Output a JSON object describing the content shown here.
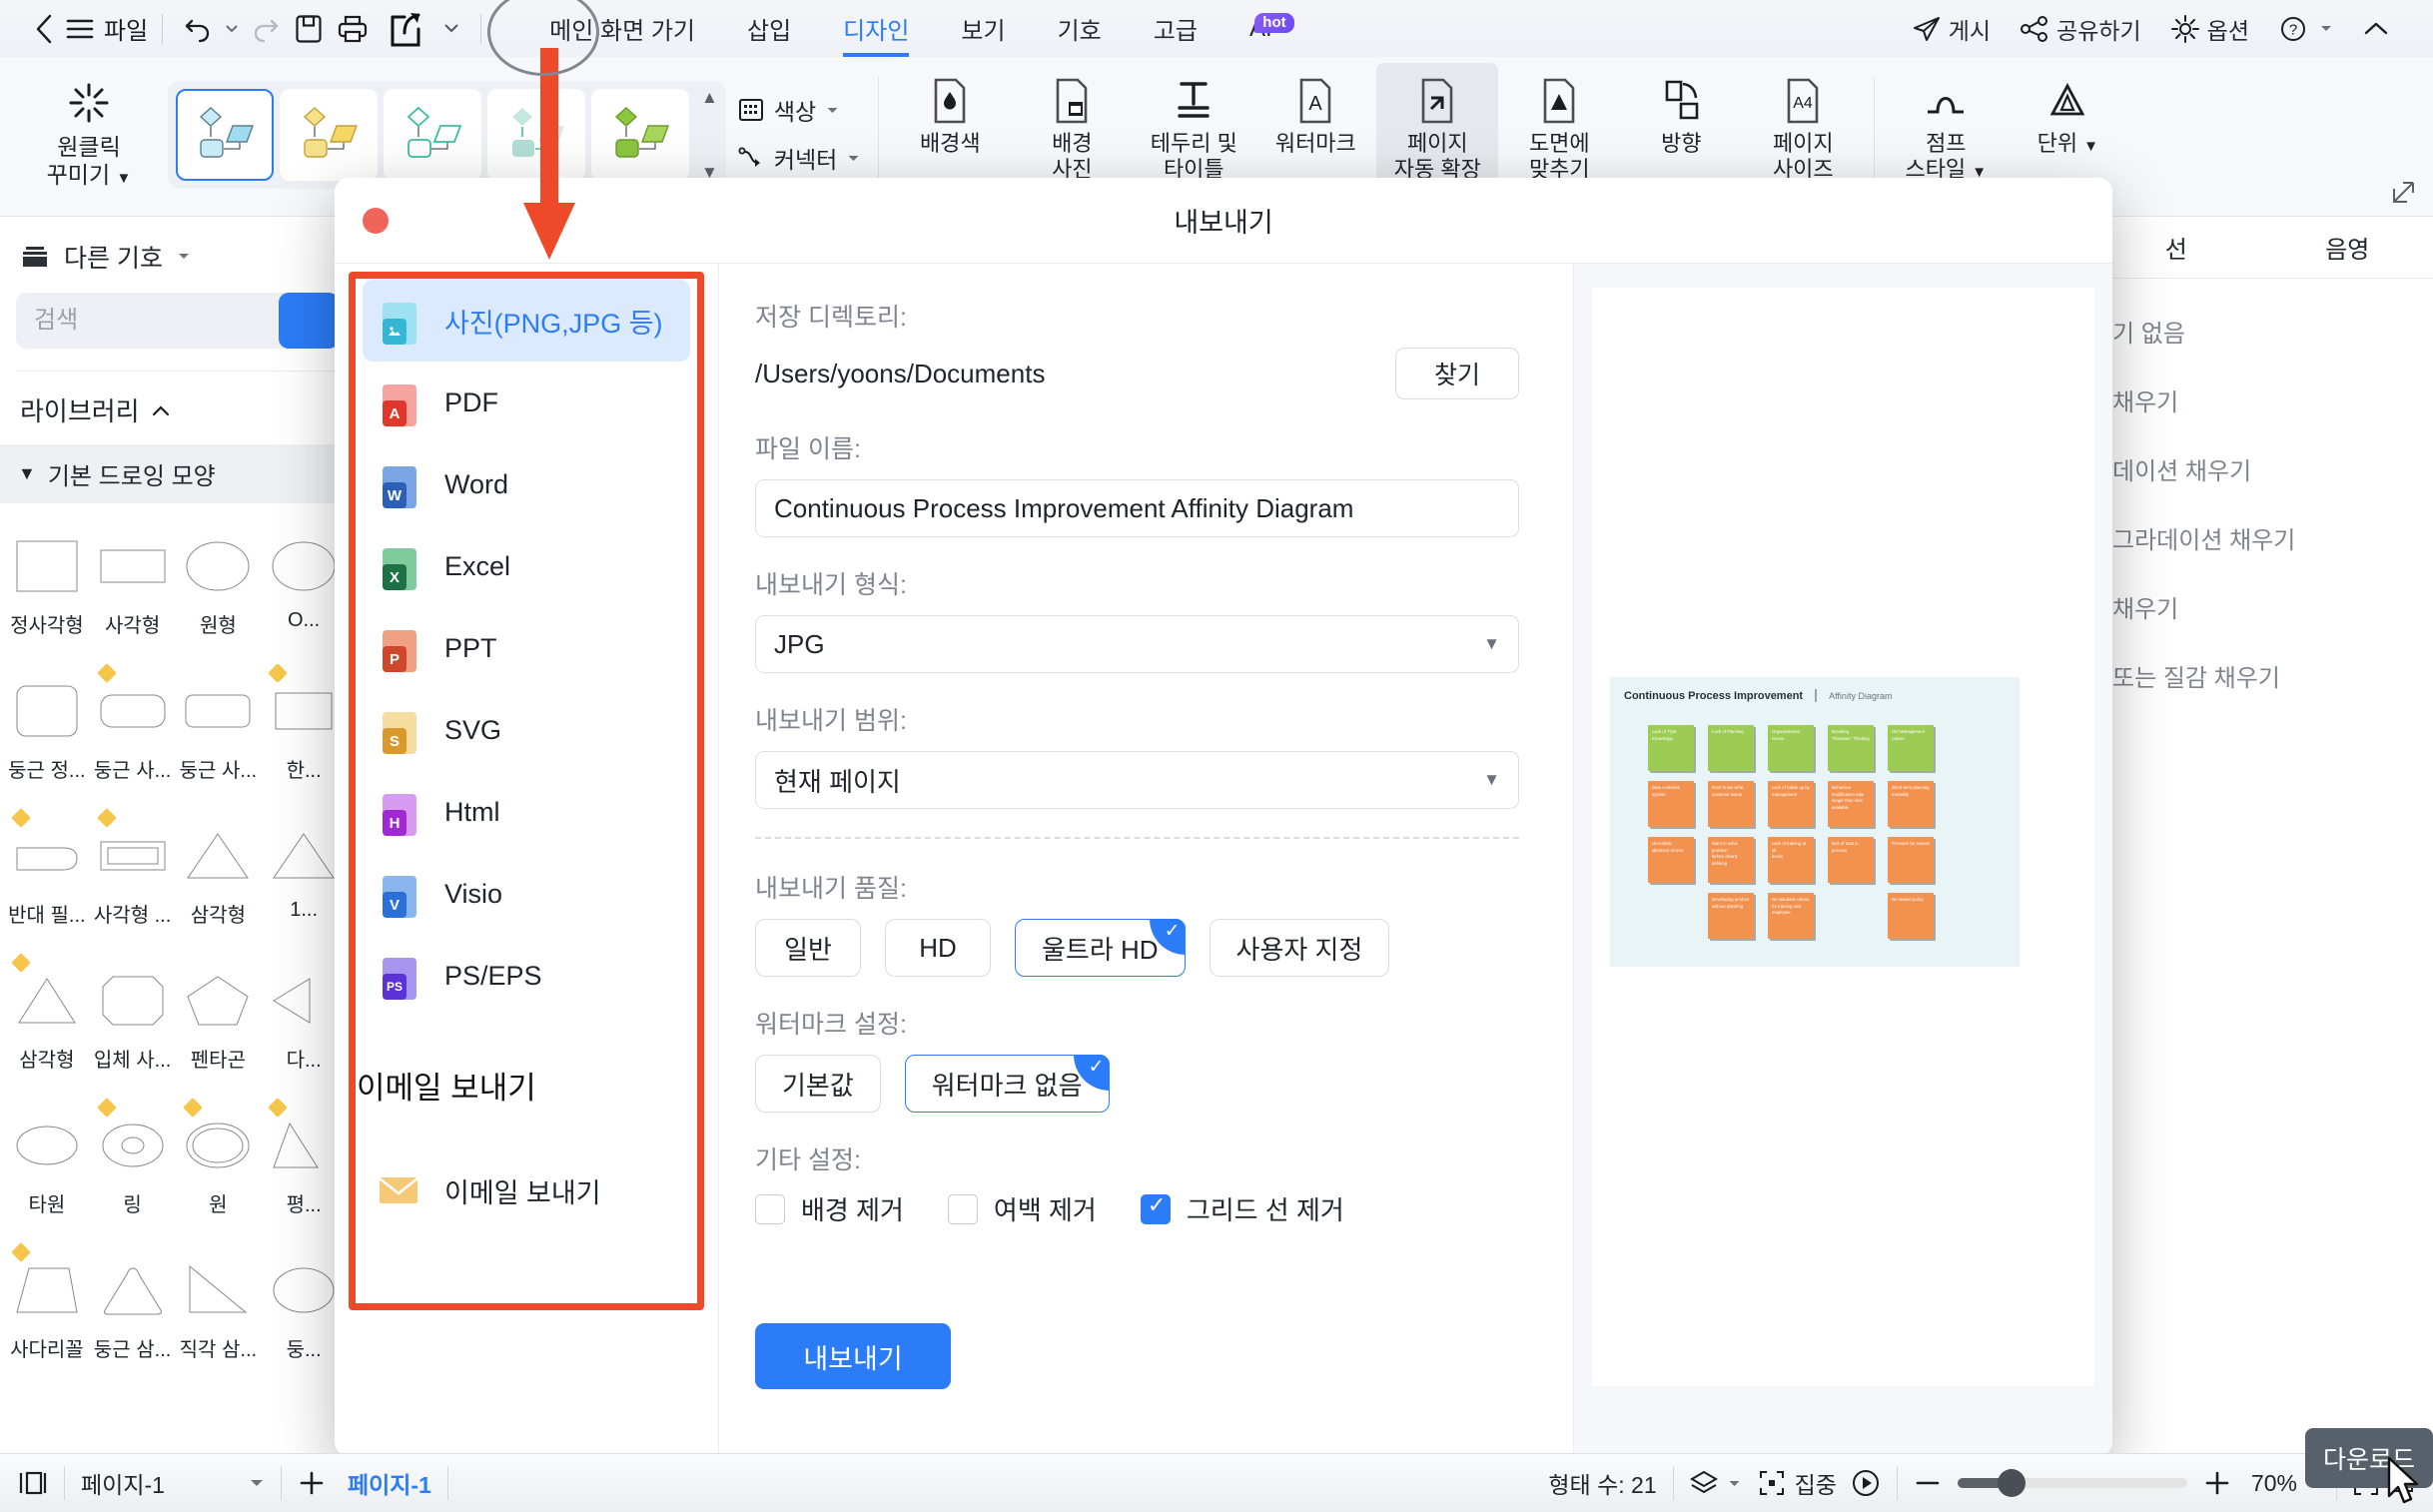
{
  "topbar": {
    "back_icon": "chevron-left-icon",
    "file_menu": "파일",
    "undo_icon": "undo-icon",
    "redo_icon": "redo-icon",
    "save_icon": "save-icon",
    "print_icon": "print-icon",
    "export_icon": "export-share-icon",
    "more_icon": "chevron-down-icon",
    "tabs": [
      {
        "label": "메인 화면 가기",
        "active": false
      },
      {
        "label": "삽입",
        "active": false
      },
      {
        "label": "디자인",
        "active": true
      },
      {
        "label": "보기",
        "active": false
      },
      {
        "label": "기호",
        "active": false
      },
      {
        "label": "고급",
        "active": false
      }
    ],
    "ai_label": "AI",
    "ai_badge": "hot",
    "right_items": [
      {
        "label": "게시",
        "icon": "publish-icon"
      },
      {
        "label": "공유하기",
        "icon": "share-nodes-icon"
      },
      {
        "label": "옵션",
        "icon": "gear-icon"
      },
      {
        "label": "",
        "icon": "help-circle-icon"
      },
      {
        "label": "",
        "icon": "collapse-ribbon-icon"
      }
    ]
  },
  "ribbon": {
    "oneclick": "원클릭\n꾸미기",
    "style_cards": [
      "style-blue",
      "style-yellow",
      "style-teal",
      "style-mint",
      "style-green"
    ],
    "mini_buttons": [
      {
        "label": "색상",
        "icon": "color-palette-icon"
      },
      {
        "label": "커넥터",
        "icon": "connector-icon"
      }
    ],
    "buttons": [
      {
        "label": "배경색",
        "icon": "background-color-icon",
        "active": false
      },
      {
        "label": "배경\n사진",
        "icon": "background-image-icon",
        "active": false
      },
      {
        "label": "테두리 및\n타이틀",
        "icon": "border-title-icon",
        "active": false
      },
      {
        "label": "워터마크",
        "icon": "watermark-icon",
        "active": false
      },
      {
        "label": "페이지\n자동 확장",
        "icon": "page-autoexpand-icon",
        "active": true
      },
      {
        "label": "도면에\n맞추기",
        "icon": "fit-to-drawing-icon",
        "active": false
      },
      {
        "label": "방향",
        "icon": "orientation-icon",
        "active": false
      },
      {
        "label": "페이지\n사이즈",
        "icon": "page-size-icon",
        "active": false
      },
      {
        "label": "점프\n스타일",
        "icon": "jump-style-icon",
        "active": false
      },
      {
        "label": "단위",
        "icon": "unit-icon",
        "active": false
      }
    ],
    "expand_icon": "dialog-launcher-icon"
  },
  "left_panel": {
    "other_symbols": "다른 기호",
    "search_placeholder": "검색",
    "search_value": "",
    "library_label": "라이브러리",
    "category": "기본 드로잉 모양",
    "shapes": [
      {
        "name": "정사각형",
        "glyph": "square"
      },
      {
        "name": "사각형",
        "glyph": "rect"
      },
      {
        "name": "원형",
        "glyph": "ellipse"
      },
      {
        "name": "O...",
        "glyph": "ellipse"
      },
      {
        "name": "둥근 정...",
        "glyph": "rounded-square"
      },
      {
        "name": "둥근 사...",
        "glyph": "rounded-rect"
      },
      {
        "name": "둥근 사...",
        "glyph": "rounded-rect"
      },
      {
        "name": "한...",
        "glyph": "rect"
      },
      {
        "name": "반대 필...",
        "glyph": "flag"
      },
      {
        "name": "사각형 ...",
        "glyph": "double-rect"
      },
      {
        "name": "삼각형",
        "glyph": "triangle"
      },
      {
        "name": "1...",
        "glyph": "triangle"
      },
      {
        "name": "삼각형",
        "glyph": "triangle"
      },
      {
        "name": "입체 사...",
        "glyph": "octagon"
      },
      {
        "name": "펜타곤",
        "glyph": "pentagon"
      },
      {
        "name": "다...",
        "glyph": "triangle"
      },
      {
        "name": "타원",
        "glyph": "ellipse"
      },
      {
        "name": "링",
        "glyph": "ring"
      },
      {
        "name": "원",
        "glyph": "circle-ring"
      },
      {
        "name": "평...",
        "glyph": "triangle"
      },
      {
        "name": "사다리꼴",
        "glyph": "trapezoid"
      },
      {
        "name": "둥근 삼...",
        "glyph": "rounded-triangle"
      },
      {
        "name": "직각 삼...",
        "glyph": "right-triangle"
      },
      {
        "name": "둥...",
        "glyph": "ellipse"
      }
    ]
  },
  "right_panel": {
    "tabs": [
      "선",
      "음영"
    ],
    "items": [
      "기 없음",
      "채우기",
      "데이션 채우기",
      "그라데이션 채우기",
      "채우기",
      "또는 질감 채우기"
    ]
  },
  "dialog": {
    "title": "내보내기",
    "close_icon": "close-dot-icon",
    "formats": [
      {
        "label": "사진(PNG,JPG 등)",
        "icon": "image-file-icon",
        "selected": true,
        "color": "#4ec3e0",
        "tag": ""
      },
      {
        "label": "PDF",
        "icon": "pdf-file-icon",
        "selected": false,
        "color": "#e0362c",
        "tag": "A"
      },
      {
        "label": "Word",
        "icon": "word-file-icon",
        "selected": false,
        "color": "#2b5fb8",
        "tag": "W"
      },
      {
        "label": "Excel",
        "icon": "excel-file-icon",
        "selected": false,
        "color": "#1d7145",
        "tag": "X"
      },
      {
        "label": "PPT",
        "icon": "ppt-file-icon",
        "selected": false,
        "color": "#d0462a",
        "tag": "P"
      },
      {
        "label": "SVG",
        "icon": "svg-file-icon",
        "selected": false,
        "color": "#d99a2b",
        "tag": "S"
      },
      {
        "label": "Html",
        "icon": "html-file-icon",
        "selected": false,
        "color": "#a228d6",
        "tag": "H"
      },
      {
        "label": "Visio",
        "icon": "visio-file-icon",
        "selected": false,
        "color": "#2b6fd8",
        "tag": "V"
      },
      {
        "label": "PS/EPS",
        "icon": "ps-file-icon",
        "selected": false,
        "color": "#5b32d6",
        "tag": "PS"
      }
    ],
    "email_section_title": "이메일 보내기",
    "email_item": {
      "label": "이메일 보내기",
      "icon": "envelope-icon"
    },
    "form": {
      "dir_label": "저장 디렉토리:",
      "dir_value": "/Users/yoons/Documents",
      "browse_button": "찾기",
      "filename_label": "파일 이름:",
      "filename_value": "Continuous Process Improvement Affinity Diagram",
      "format_label": "내보내기 형식:",
      "format_value": "JPG",
      "range_label": "내보내기 범위:",
      "range_value": "현재 페이지",
      "quality_label": "내보내기 품질:",
      "quality_options": [
        {
          "label": "일반",
          "selected": false
        },
        {
          "label": "HD",
          "selected": false
        },
        {
          "label": "울트라 HD",
          "selected": true
        },
        {
          "label": "사용자 지정",
          "selected": false
        }
      ],
      "watermark_label": "워터마크 설정:",
      "watermark_options": [
        {
          "label": "기본값",
          "selected": false
        },
        {
          "label": "워터마크 없음",
          "selected": true
        }
      ],
      "other_label": "기타 설정:",
      "checkboxes": [
        {
          "label": "배경 제거",
          "checked": false
        },
        {
          "label": "여백 제거",
          "checked": false
        },
        {
          "label": "그리드 선 제거",
          "checked": true
        }
      ],
      "export_button": "내보내기"
    },
    "preview": {
      "diagram": {
        "title": "Continuous Process Improvement",
        "subtitle": "Affinity Diagram",
        "columns": [
          {
            "header": "Lack of TQM Knowledge",
            "cards": [
              "Data collection system",
              "Unrealistic allotment of time"
            ]
          },
          {
            "header": "Lack of Planning",
            "cards": [
              "Dont' know what customer wants",
              "Want to solve problem\nbefore clearly defining",
              "Developing product without planning"
            ]
          },
          {
            "header": "Organizational issues",
            "cards": [
              "Lack of follow up by management",
              "Lack of training at all\nlevels",
              "No standard criteria for training new employee"
            ]
          },
          {
            "header": "Breaking \"Dinosaur\" Thinking",
            "cards": [
              "Behaviour modification take longer then time available",
              "lack of trust in process"
            ]
          },
          {
            "header": "Old Management culture",
            "cards": [
              "Short term planning\nmentality",
              "Pressure for sucess",
              "No reward policy"
            ]
          }
        ]
      }
    }
  },
  "statusbar": {
    "layout_icon": "page-layout-icon",
    "page_name": "페이지-1",
    "page_dropdown_icon": "chevron-down-icon",
    "add_page_icon": "plus-icon",
    "active_tab": "페이지-1",
    "shape_count": "형태 수: 21",
    "layers_icon": "layers-icon",
    "focus_icon": "focus-frame-icon",
    "focus_label": "집중",
    "play_icon": "play-circle-icon",
    "zoom_out_icon": "minus-icon",
    "zoom_in_icon": "plus-icon",
    "zoom_level": "70%",
    "fit_icon": "fit-page-icon",
    "fullscreen_icon": "fullscreen-icon",
    "download_tooltip": "다운로드"
  },
  "colors": {
    "accent": "#2b7cf6",
    "annotation": "#ee4a29",
    "green_card": "#9ccc52",
    "orange_card": "#f3914f",
    "diagram_bg": "#e9f4f6"
  }
}
